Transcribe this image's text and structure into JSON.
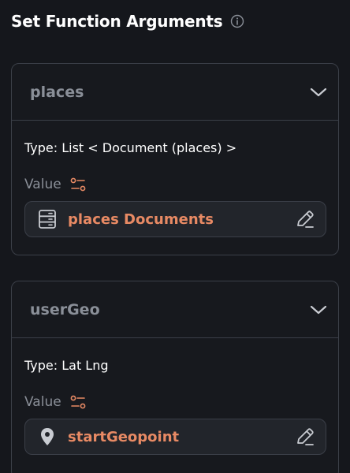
{
  "header": {
    "title": "Set Function Arguments",
    "info_icon": "info-icon"
  },
  "arguments": [
    {
      "name": "places",
      "type_line": "Type: List < Document (places) >",
      "value_label": "Value",
      "value_text": "places Documents",
      "lead_icon": "database-icon"
    },
    {
      "name": "userGeo",
      "type_line": "Type: Lat Lng",
      "value_label": "Value",
      "value_text": "startGeopoint",
      "lead_icon": "location-pin-icon"
    }
  ],
  "colors": {
    "background": "#15171c",
    "card_border": "#3b3f48",
    "accent": "#e88a64",
    "muted_text": "#8a8f98",
    "value_box": "#22252b"
  }
}
